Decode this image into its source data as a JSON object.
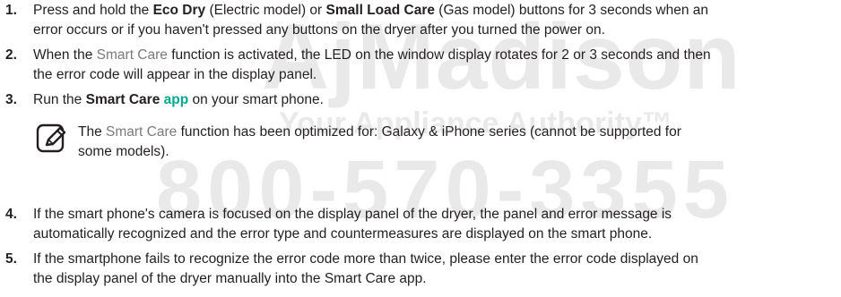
{
  "watermark": {
    "name": "AjMadison",
    "tagline": "Your Appliance Authority™",
    "phone": "800-570-3355"
  },
  "steps": [
    {
      "number": "1.",
      "line1_a": "Press and hold the ",
      "line1_b": "Eco Dry",
      "line1_c": " (Electric model) or ",
      "line1_d": "Small Load Care",
      "line1_e": " (Gas model) buttons for 3 seconds when an",
      "line2": "error occurs or if you haven't pressed any buttons on the dryer after you turned the power on."
    },
    {
      "number": "2.",
      "line1_a": "When the ",
      "line1_b": "Smart Care",
      "line1_c": " function is activated, the LED on the window display rotates for 2 or 3 seconds and then",
      "line2": "the error code will appear in the display panel."
    },
    {
      "number": "3.",
      "line1_a": "Run the ",
      "line1_b": "Smart Care ",
      "line1_c": "app",
      "line1_d": " on your smart phone."
    },
    {
      "number": "4.",
      "line1": "If the smart phone's camera is focused on the display panel of the dryer, the panel and error message is",
      "line2": "automatically recognized and the error type and countermeasures are displayed on the smart phone."
    },
    {
      "number": "5.",
      "line1": "If the smartphone fails to recognize the error code more than twice, please enter the error code displayed on",
      "line2": "the display panel of the dryer manually into the Smart Care app."
    }
  ],
  "note": {
    "icon": "note-pencil-icon",
    "line1_a": "The ",
    "line1_b": "Smart Care",
    "line1_c": " function has been optimized for: Galaxy & iPhone series (cannot be supported for",
    "line2": "some models)."
  }
}
